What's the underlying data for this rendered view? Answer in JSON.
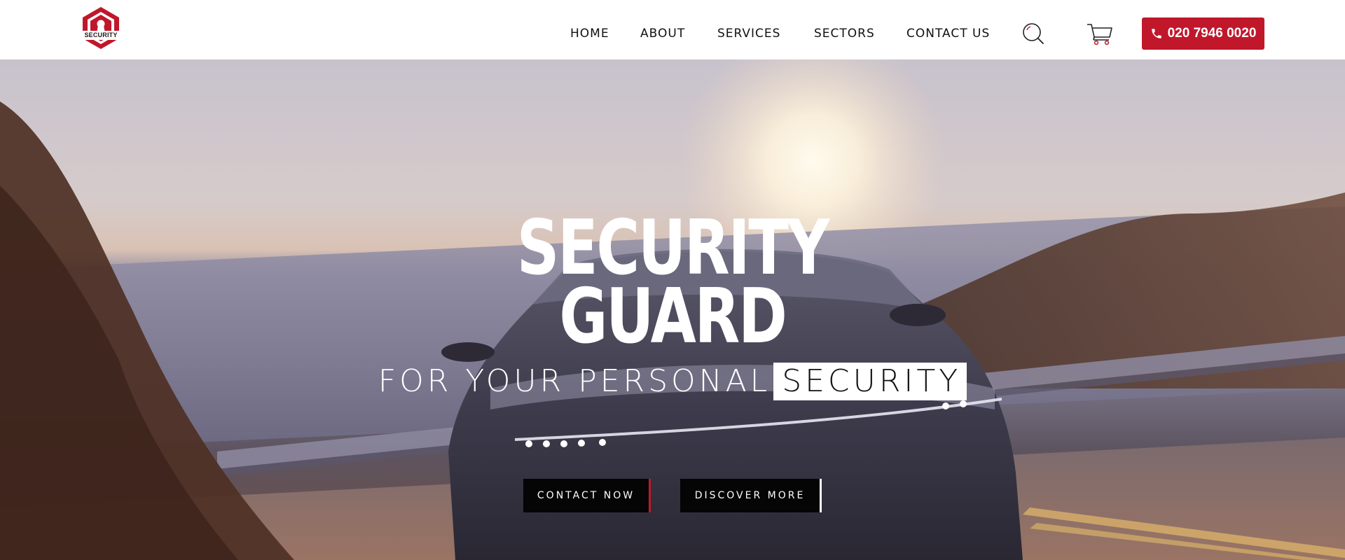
{
  "brand": {
    "logo_text": "SECURITY",
    "accent_color": "#c0172b",
    "logo_icon": "hexagon-lock-icon"
  },
  "nav": {
    "items": [
      {
        "label": "HOME"
      },
      {
        "label": "ABOUT"
      },
      {
        "label": "SERVICES"
      },
      {
        "label": "SECTORS"
      },
      {
        "label": "CONTACT US"
      }
    ],
    "search_icon": "search-icon",
    "cart_icon": "cart-icon",
    "phone_label": "020 7946 0020",
    "phone_icon": "phone-icon"
  },
  "hero": {
    "title_line1": "SECURITY",
    "title_line2": "GUARD",
    "subtitle": "FOR YOUR PERSONAL",
    "subtitle_highlight": "SECURITY",
    "cta_primary": "CONTACT NOW",
    "cta_secondary": "DISCOVER MORE",
    "background_image": "car on coastal road at sunset"
  }
}
